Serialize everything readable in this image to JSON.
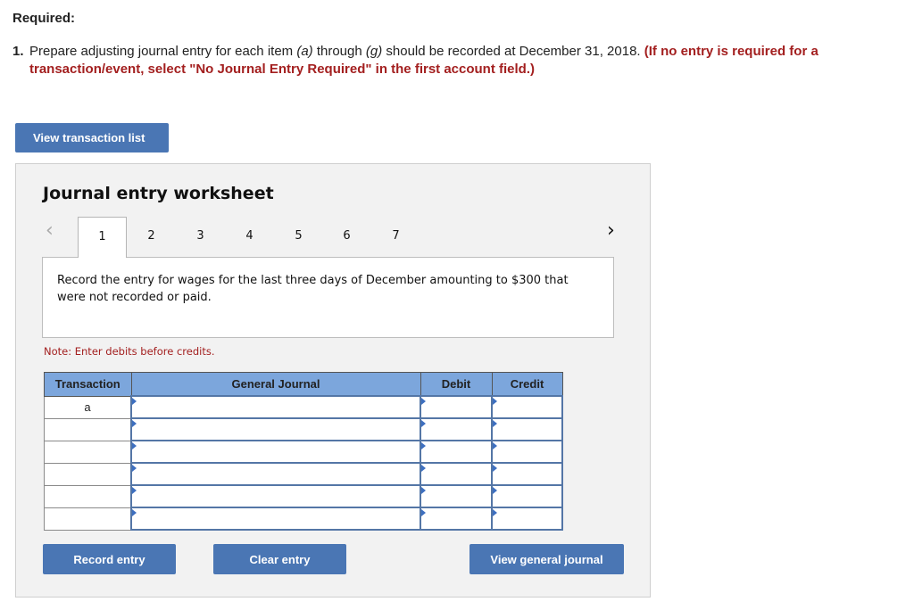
{
  "required_heading": "Required:",
  "instruction": {
    "number": "1.",
    "text_part1": "Prepare adjusting journal entry for each item ",
    "item_a": "(a)",
    "text_part2": " through ",
    "item_g": "(g)",
    "text_part3": " should be recorded at December 31, 2018. ",
    "red_line1": "(If no entry is required for a",
    "red_line2": "transaction/event, select \"No Journal Entry Required\" in the first account field.)"
  },
  "view_transaction_list_label": "View transaction list",
  "worksheet": {
    "title": "Journal entry worksheet",
    "prev_icon": "chevron-left-icon",
    "next_icon": "chevron-right-icon",
    "tabs": [
      "1",
      "2",
      "3",
      "4",
      "5",
      "6",
      "7"
    ],
    "active_tab": "1",
    "description": "Record the entry for wages for the last three days of December amounting to $300 that were not recorded or paid.",
    "note": "Note: Enter debits before credits.",
    "table": {
      "headers": [
        "Transaction",
        "General Journal",
        "Debit",
        "Credit"
      ],
      "rows": [
        {
          "transaction": "a",
          "account": "",
          "debit": "",
          "credit": ""
        },
        {
          "transaction": "",
          "account": "",
          "debit": "",
          "credit": ""
        },
        {
          "transaction": "",
          "account": "",
          "debit": "",
          "credit": ""
        },
        {
          "transaction": "",
          "account": "",
          "debit": "",
          "credit": ""
        },
        {
          "transaction": "",
          "account": "",
          "debit": "",
          "credit": ""
        },
        {
          "transaction": "",
          "account": "",
          "debit": "",
          "credit": ""
        }
      ]
    },
    "buttons": {
      "record": "Record entry",
      "clear": "Clear entry",
      "view_journal": "View general journal"
    }
  },
  "colors": {
    "button_blue": "#4a76b4",
    "header_blue": "#7ca6dc",
    "cell_border": "#5476a6",
    "note_red": "#a31f1f"
  }
}
